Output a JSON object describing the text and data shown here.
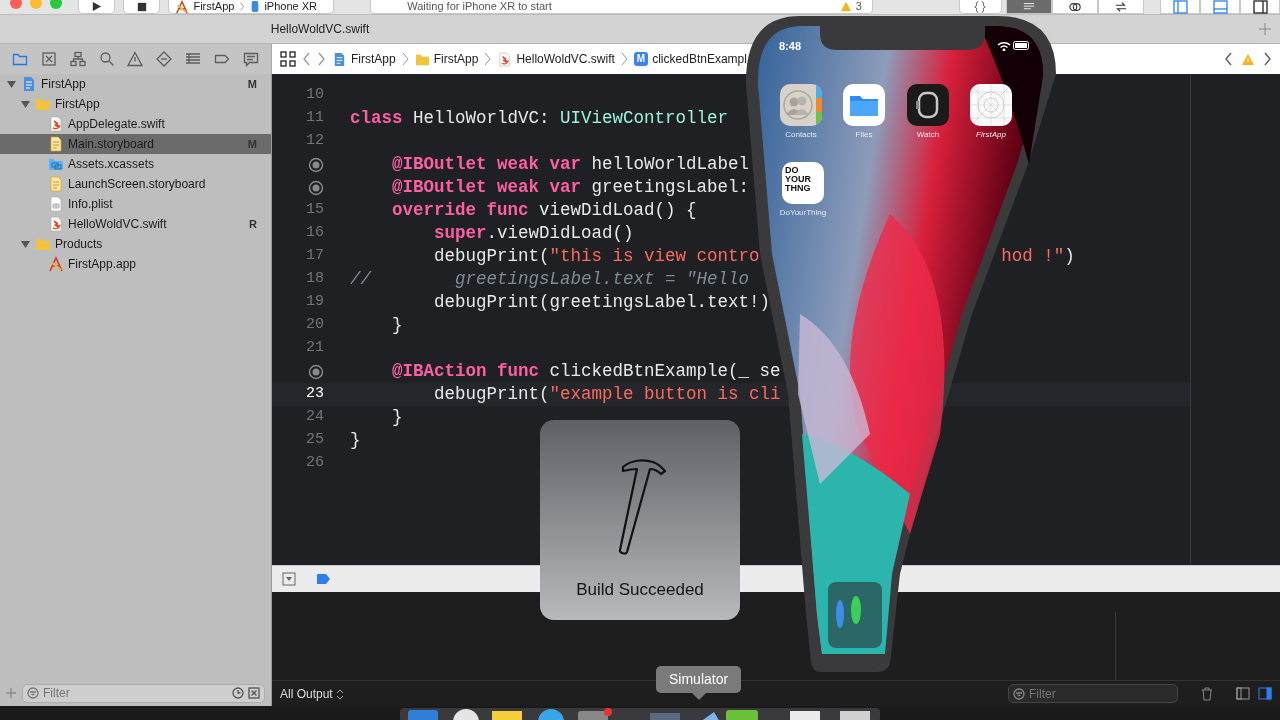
{
  "toolbar": {
    "scheme_app": "FirstApp",
    "scheme_device": "iPhone XR",
    "activity": "Waiting for iPhone XR to start",
    "warning_count": "3",
    "editor_modes": [
      {
        "kind": "standard",
        "selected": true
      },
      {
        "kind": "assistant",
        "selected": false
      },
      {
        "kind": "version",
        "selected": false
      }
    ],
    "panels": [
      {
        "kind": "navigator",
        "on": true
      },
      {
        "kind": "debug",
        "on": true
      },
      {
        "kind": "inspector",
        "on": false
      }
    ]
  },
  "tab": {
    "title": "HelloWoldVC.swift"
  },
  "navigator_tabs": [
    {
      "kind": "folder",
      "selected": true
    },
    {
      "kind": "box",
      "selected": false
    },
    {
      "kind": "hierarchy",
      "selected": false
    },
    {
      "kind": "search",
      "selected": false
    },
    {
      "kind": "warning",
      "selected": false
    },
    {
      "kind": "diamond",
      "selected": false
    },
    {
      "kind": "list",
      "selected": false
    },
    {
      "kind": "tag",
      "selected": false
    },
    {
      "kind": "bubble",
      "selected": false
    }
  ],
  "jump_bar": {
    "crumbs": [
      {
        "kind": "project",
        "label": "FirstApp"
      },
      {
        "kind": "folder",
        "label": "FirstApp"
      },
      {
        "kind": "swift",
        "label": "HelloWoldVC.swift"
      },
      {
        "kind": "method",
        "badge": "M",
        "label": "clickedBtnExampl"
      }
    ]
  },
  "navigator": {
    "tree": [
      {
        "kind": "project",
        "label": "FirstApp",
        "status": "M",
        "expanded": true,
        "selected": false,
        "children": [
          {
            "kind": "folder",
            "label": "FirstApp",
            "expanded": true,
            "selected": false,
            "children": [
              {
                "kind": "swift",
                "label": "AppDelegate.swift",
                "selected": false
              },
              {
                "kind": "storyboard",
                "label": "Main.storyboard",
                "status": "M",
                "selected": true
              },
              {
                "kind": "xcassets",
                "label": "Assets.xcassets",
                "selected": false
              },
              {
                "kind": "storyboard",
                "label": "LaunchScreen.storyboard",
                "selected": false
              },
              {
                "kind": "plist",
                "label": "Info.plist",
                "selected": false
              },
              {
                "kind": "swift",
                "label": "HelloWoldVC.swift",
                "status": "R",
                "selected": false
              }
            ]
          },
          {
            "kind": "folder",
            "label": "Products",
            "expanded": true,
            "selected": false,
            "children": [
              {
                "kind": "app",
                "label": "FirstApp.app",
                "selected": false
              }
            ]
          }
        ]
      }
    ],
    "filter_placeholder": "Filter"
  },
  "editor": {
    "lines": [
      {
        "kind": "numbered",
        "number": "10"
      },
      {
        "kind": "numbered",
        "number": "11",
        "tokens": [
          {
            "kind": "keyword",
            "text": "class"
          },
          {
            "kind": "plain",
            "text": " HelloWorldVC: "
          },
          {
            "kind": "type",
            "text": "UIViewController"
          }
        ]
      },
      {
        "kind": "numbered",
        "number": "12"
      },
      {
        "kind": "connection",
        "tokens": [
          {
            "kind": "keyword",
            "text": "    @IBOutlet weak var"
          },
          {
            "kind": "plain",
            "text": " helloWorldLabel"
          }
        ]
      },
      {
        "kind": "connection",
        "tokens": [
          {
            "kind": "keyword",
            "text": "    @IBOutlet weak var"
          },
          {
            "kind": "plain",
            "text": " greetingsLabel:"
          }
        ]
      },
      {
        "kind": "numbered",
        "number": "15",
        "tokens": [
          {
            "kind": "keyword",
            "text": "    override func"
          },
          {
            "kind": "plain",
            "text": " viewDidLoad() {"
          }
        ]
      },
      {
        "kind": "numbered",
        "number": "16",
        "tokens": [
          {
            "kind": "keyword",
            "text": "        super"
          },
          {
            "kind": "plain",
            "text": ".viewDidLoad()"
          }
        ]
      },
      {
        "kind": "numbered",
        "number": "17",
        "tokens": [
          {
            "kind": "plain",
            "text": "        debugPrint("
          },
          {
            "kind": "string",
            "text": "\"this is view contro"
          }
        ],
        "tail": [
          {
            "kind": "string",
            "text": "hod !\""
          },
          {
            "kind": "plain",
            "text": ")"
          }
        ]
      },
      {
        "kind": "numbered",
        "number": "18",
        "tokens": [
          {
            "kind": "comment",
            "text": "//        greetingsLabel.text = \"Hello"
          }
        ]
      },
      {
        "kind": "numbered",
        "number": "19",
        "tokens": [
          {
            "kind": "plain",
            "text": "        debugPrint(greetingsLabel.text!)"
          }
        ]
      },
      {
        "kind": "numbered",
        "number": "20",
        "tokens": [
          {
            "kind": "plain",
            "text": "    }"
          }
        ]
      },
      {
        "kind": "numbered",
        "number": "21"
      },
      {
        "kind": "connection",
        "tokens": [
          {
            "kind": "keyword",
            "text": "    @IBAction func"
          },
          {
            "kind": "plain",
            "text": " clickedBtnExample(_ se"
          }
        ]
      },
      {
        "kind": "numbered",
        "number": "23",
        "current": true,
        "tokens": [
          {
            "kind": "plain",
            "text": "        debugPrint("
          },
          {
            "kind": "string",
            "text": "\"example button is cli"
          }
        ]
      },
      {
        "kind": "numbered",
        "number": "24",
        "tokens": [
          {
            "kind": "plain",
            "text": "    }"
          }
        ]
      },
      {
        "kind": "numbered",
        "number": "25",
        "tokens": [
          {
            "kind": "plain",
            "text": "}"
          }
        ]
      },
      {
        "kind": "numbered",
        "number": "26"
      }
    ]
  },
  "debug_bar": {
    "breakpoints_active": true
  },
  "console": {
    "scope": "All Output",
    "filter_placeholder": "Filter",
    "panes": [
      {
        "kind": "variables",
        "on": false
      },
      {
        "kind": "console",
        "on": true
      }
    ]
  },
  "hud": {
    "message": "Build Succeeded"
  },
  "tooltip": {
    "text": "Simulator"
  },
  "simulator": {
    "time": "8:48",
    "apps": [
      {
        "kind": "contacts",
        "name": "Contacts"
      },
      {
        "kind": "files",
        "name": "Files"
      },
      {
        "kind": "watch",
        "name": "Watch"
      },
      {
        "kind": "blank",
        "name": "FirstApp"
      },
      {
        "kind": "logo",
        "name": "DoYourThing",
        "logo_lines": [
          "DO",
          "YOUR",
          "THNG"
        ]
      }
    ]
  }
}
